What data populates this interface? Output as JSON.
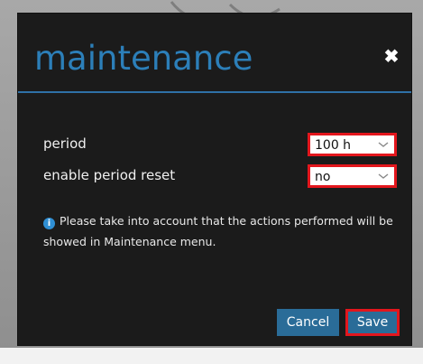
{
  "dialog": {
    "title": "maintenance",
    "close_icon": "close-icon"
  },
  "form": {
    "period": {
      "label": "period",
      "selected": "100 h"
    },
    "enable_period_reset": {
      "label": "enable period reset",
      "selected": "no"
    }
  },
  "info": {
    "icon": "info-icon",
    "text": "Please take into account that the actions performed will be showed in Maintenance menu."
  },
  "buttons": {
    "cancel_label": "Cancel",
    "save_label": "Save"
  },
  "colors": {
    "title": "#2c7fb9",
    "divider": "#2f71a7",
    "button": "#2a6c98",
    "highlight": "#e3161d",
    "modal_bg": "#1b1b1b"
  }
}
